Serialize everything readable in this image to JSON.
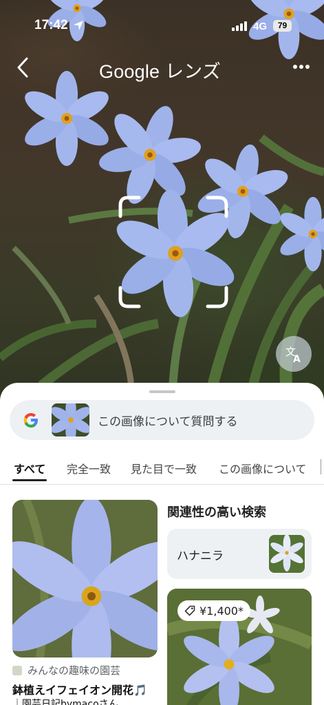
{
  "status_bar": {
    "time": "17:42",
    "network": "4G",
    "battery": "79"
  },
  "header": {
    "title": "Google レンズ"
  },
  "sheet": {
    "ask_placeholder": "この画像について質問する",
    "tabs": [
      {
        "label": "すべて",
        "active": true
      },
      {
        "label": "完全一致",
        "active": false
      },
      {
        "label": "見た目で一致",
        "active": false
      },
      {
        "label": "この画像について",
        "active": false
      }
    ],
    "results": {
      "first": {
        "source": "みんなの趣味の園芸",
        "title": "鉢植えイフェイオン開花🎵",
        "title_line2": "｜園芸日記bymacoさん…"
      },
      "related_heading": "関連性の高い検索",
      "related_item": {
        "label": "ハナニラ"
      },
      "second": {
        "price": "¥1,400*"
      }
    }
  },
  "colors": {
    "accent": "#1a73e8",
    "sheet_bg": "#ffffff",
    "chip_bg": "#eef1f3",
    "flower": "#9fb3ea"
  },
  "icons": [
    "location-arrow-icon",
    "signal-icon",
    "battery-icon",
    "back-chevron-icon",
    "more-dots-icon",
    "focus-frame-icon",
    "translate-icon",
    "google-g-icon",
    "price-tag-icon"
  ]
}
